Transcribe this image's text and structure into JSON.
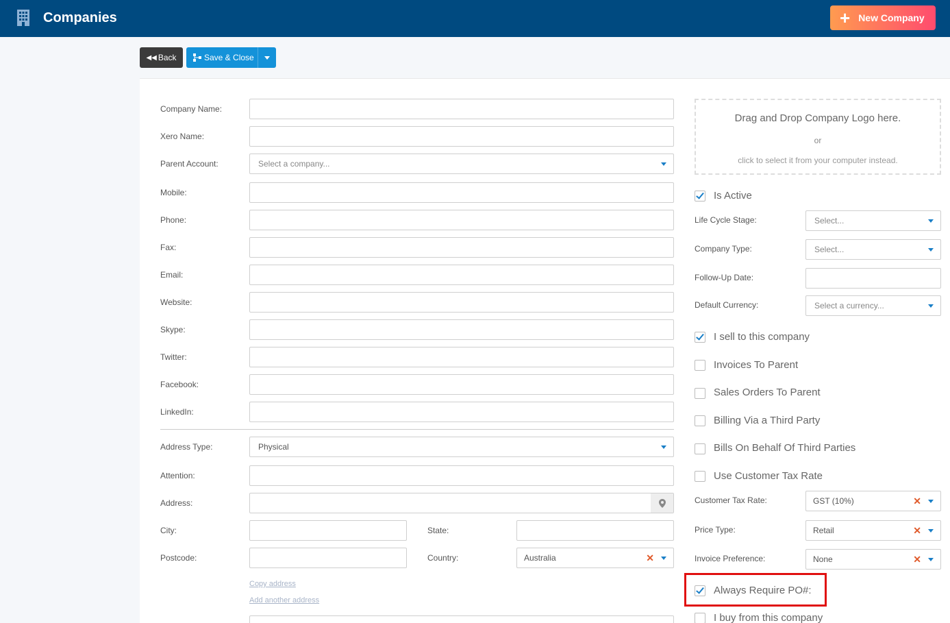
{
  "header": {
    "title": "Companies",
    "new_button": "New Company"
  },
  "toolbar": {
    "back": "Back",
    "save_close": "Save & Close"
  },
  "form": {
    "company_name": {
      "label": "Company Name:",
      "value": ""
    },
    "xero_name": {
      "label": "Xero Name:",
      "value": ""
    },
    "parent_account": {
      "label": "Parent Account:",
      "placeholder": "Select a company..."
    },
    "mobile": {
      "label": "Mobile:",
      "value": ""
    },
    "phone": {
      "label": "Phone:",
      "value": ""
    },
    "fax": {
      "label": "Fax:",
      "value": ""
    },
    "email": {
      "label": "Email:",
      "value": ""
    },
    "website": {
      "label": "Website:",
      "value": ""
    },
    "skype": {
      "label": "Skype:",
      "value": ""
    },
    "twitter": {
      "label": "Twitter:",
      "value": ""
    },
    "facebook": {
      "label": "Facebook:",
      "value": ""
    },
    "linkedin": {
      "label": "LinkedIn:",
      "value": ""
    },
    "address_type": {
      "label": "Address Type:",
      "value": "Physical"
    },
    "attention": {
      "label": "Attention:",
      "value": ""
    },
    "address": {
      "label": "Address:",
      "value": ""
    },
    "city": {
      "label": "City:",
      "value": ""
    },
    "state": {
      "label": "State:",
      "value": ""
    },
    "postcode": {
      "label": "Postcode:",
      "value": ""
    },
    "country": {
      "label": "Country:",
      "value": "Australia"
    },
    "copy_address": "Copy address",
    "add_another_address": "Add another address"
  },
  "logo": {
    "line1": "Drag and Drop Company Logo here.",
    "line2": "or",
    "line3": "click to select it from your computer instead."
  },
  "right": {
    "is_active": {
      "label": "Is Active",
      "checked": true
    },
    "life_cycle": {
      "label": "Life Cycle Stage:",
      "placeholder": "Select..."
    },
    "company_type": {
      "label": "Company Type:",
      "placeholder": "Select..."
    },
    "follow_up": {
      "label": "Follow-Up Date:",
      "value": ""
    },
    "currency": {
      "label": "Default Currency:",
      "placeholder": "Select a currency..."
    },
    "sell_to": {
      "label": "I sell to this company",
      "checked": true
    },
    "invoices_parent": {
      "label": "Invoices To Parent",
      "checked": false
    },
    "sales_orders_parent": {
      "label": "Sales Orders To Parent",
      "checked": false
    },
    "billing_third": {
      "label": "Billing Via a Third Party",
      "checked": false
    },
    "bills_behalf": {
      "label": "Bills On Behalf Of Third Parties",
      "checked": false
    },
    "use_tax_rate": {
      "label": "Use Customer Tax Rate",
      "checked": false
    },
    "customer_tax_rate": {
      "label": "Customer Tax Rate:",
      "value": "GST (10%)"
    },
    "price_type": {
      "label": "Price Type:",
      "value": "Retail"
    },
    "invoice_pref": {
      "label": "Invoice Preference:",
      "value": "None"
    },
    "always_po": {
      "label": "Always Require PO#:",
      "checked": true
    },
    "buy_from": {
      "label": "I buy from this company",
      "checked": false
    }
  },
  "colors": {
    "header_bg": "#004a80",
    "accent": "#1492d9",
    "highlight": "#e01010"
  }
}
